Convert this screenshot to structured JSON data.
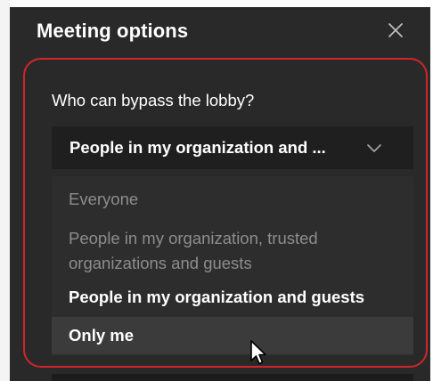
{
  "panel": {
    "title": "Meeting options",
    "close_icon": "close-icon"
  },
  "lobby_setting": {
    "question": "Who can bypass the lobby?",
    "selected_value": "People in my organization and ...",
    "chevron_icon": "chevron-down-icon",
    "options": [
      {
        "label": "Everyone",
        "state": "disabled"
      },
      {
        "label": "People in my organization, trusted organizations and guests",
        "state": "disabled"
      },
      {
        "label": "People in my organization and guests",
        "state": "enabled"
      },
      {
        "label": "Only me",
        "state": "hovered"
      }
    ]
  },
  "colors": {
    "panel_background": "#292929",
    "highlight_border": "#d2252b",
    "disabled_text": "#8d8d8d"
  }
}
